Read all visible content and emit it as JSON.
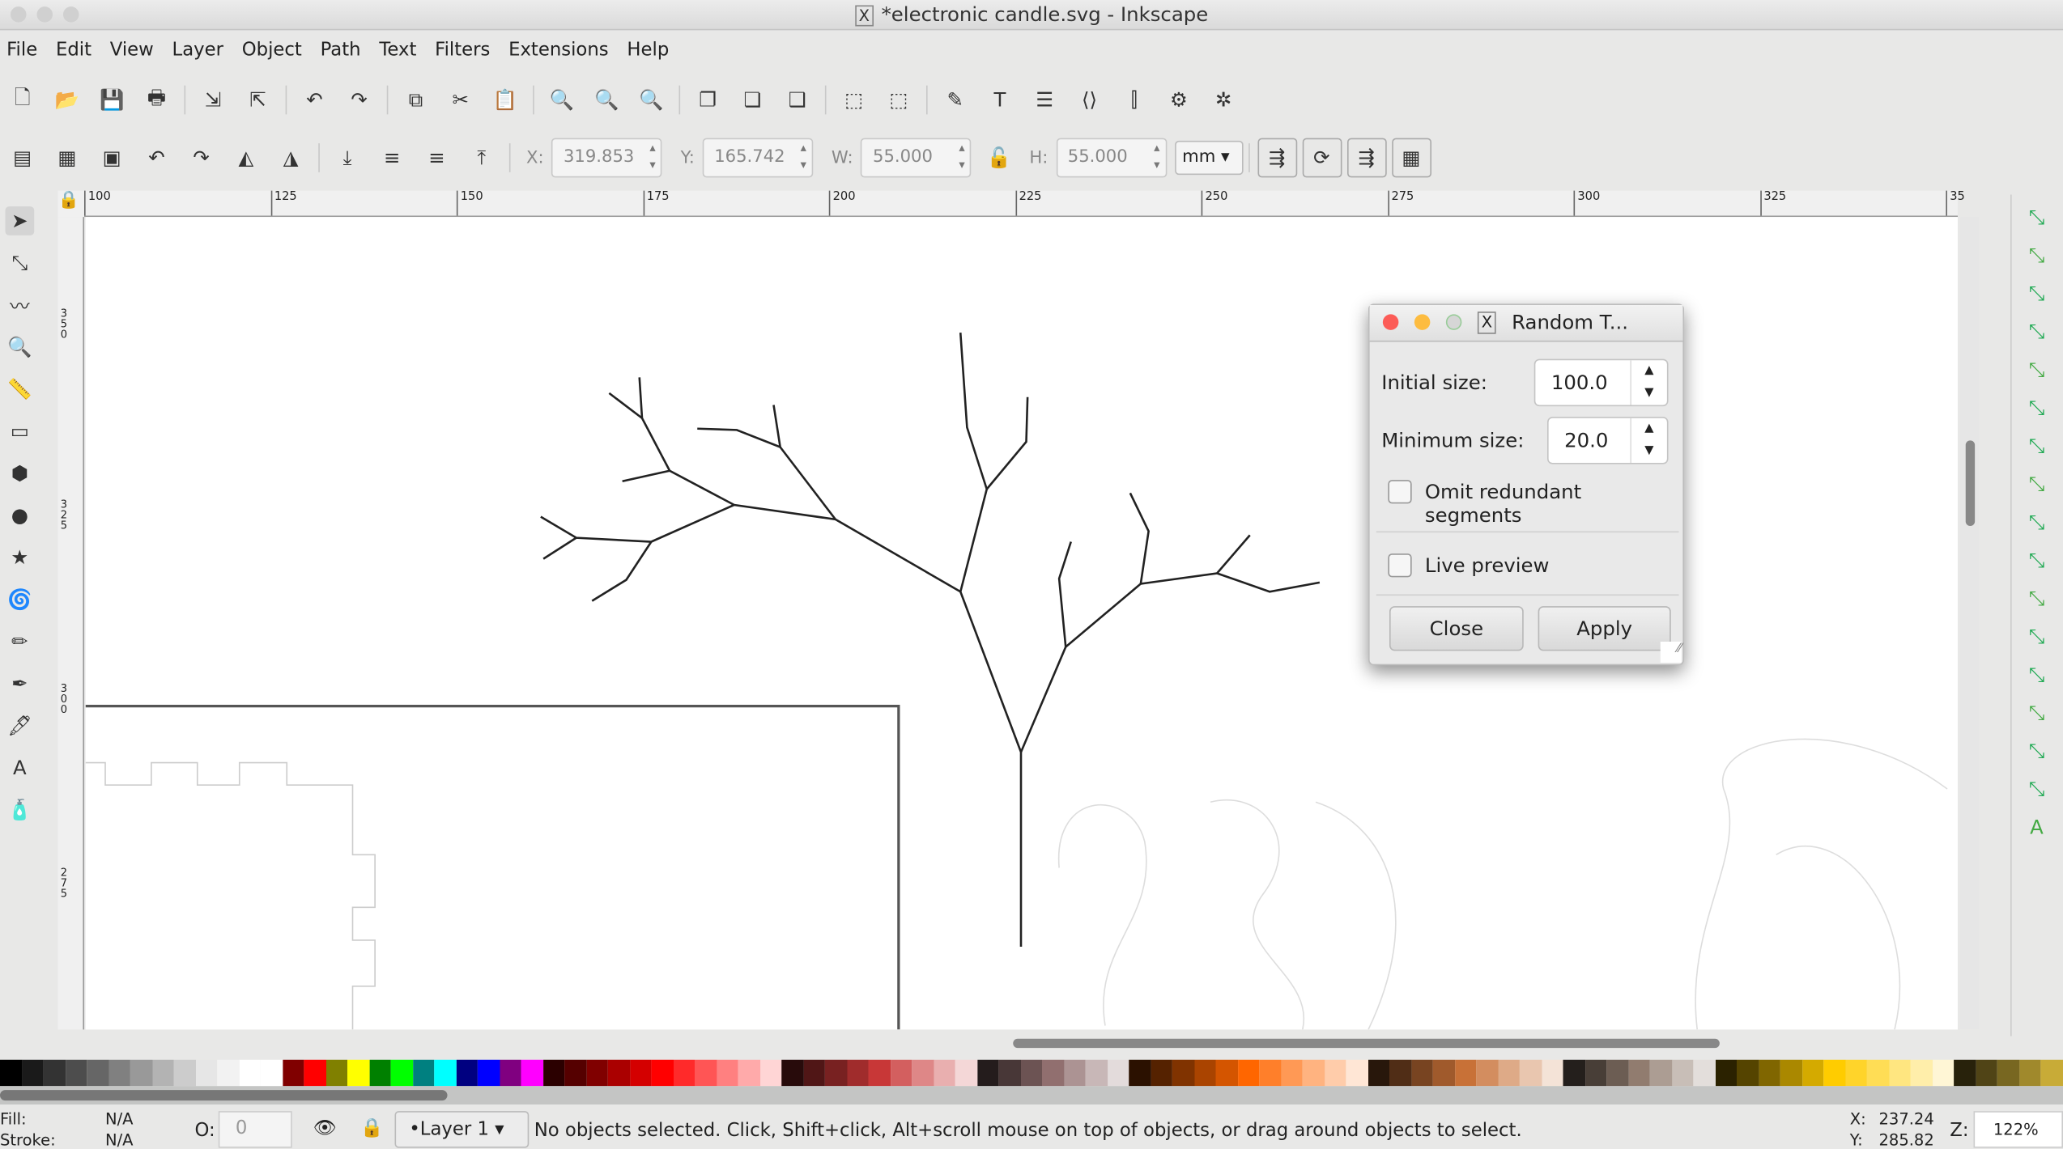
{
  "window": {
    "title": "*electronic candle.svg - Inkscape"
  },
  "menu": [
    "File",
    "Edit",
    "View",
    "Layer",
    "Object",
    "Path",
    "Text",
    "Filters",
    "Extensions",
    "Help"
  ],
  "toolbar_icons": [
    "new-document-icon",
    "open-icon",
    "save-icon",
    "print-icon",
    "import-icon",
    "export-icon",
    "undo-icon",
    "redo-icon",
    "copy-icon",
    "cut-icon",
    "paste-icon",
    "zoom-selection-icon",
    "zoom-drawing-icon",
    "zoom-page-icon",
    "duplicate-icon",
    "clone-icon",
    "unlink-clone-icon",
    "group-icon",
    "ungroup-icon",
    "fill-stroke-icon",
    "text-font-icon",
    "layers-icon",
    "xml-editor-icon",
    "align-icon",
    "document-properties-icon",
    "preferences-icon"
  ],
  "select_toolbar": {
    "x_label": "X:",
    "x": "319.853",
    "y_label": "Y:",
    "y": "165.742",
    "w_label": "W:",
    "w": "55.000",
    "h_label": "H:",
    "h": "55.000",
    "unit": "mm"
  },
  "ruler_top": [
    "100",
    "125",
    "150",
    "175",
    "200",
    "225",
    "250",
    "275",
    "300",
    "325",
    "35"
  ],
  "ruler_left": [
    "350",
    "325",
    "300",
    "275"
  ],
  "tools": [
    "selector-tool-icon",
    "node-tool-icon",
    "tweak-tool-icon",
    "zoom-tool-icon",
    "measure-tool-icon",
    "rectangle-tool-icon",
    "3d-box-tool-icon",
    "ellipse-tool-icon",
    "star-tool-icon",
    "spiral-tool-icon",
    "pencil-tool-icon",
    "pen-tool-icon",
    "calligraphy-tool-icon",
    "text-tool-icon",
    "spray-tool-icon"
  ],
  "dialog": {
    "title": "Random T...",
    "initial_size_label": "Initial size:",
    "initial_size": "100.0",
    "minimum_size_label": "Minimum size:",
    "minimum_size": "20.0",
    "omit_label": "Omit redundant segments",
    "omit_checked": false,
    "live_preview_label": "Live preview",
    "live_preview_checked": false,
    "close": "Close",
    "apply": "Apply"
  },
  "palette": [
    "#000000",
    "#1a1a1a",
    "#333333",
    "#4d4d4d",
    "#666666",
    "#808080",
    "#999999",
    "#b3b3b3",
    "#cccccc",
    "#e6e6e6",
    "#f2f2f2",
    "#ffffff",
    "#ffffff",
    "#800000",
    "#ff0000",
    "#808000",
    "#ffff00",
    "#008000",
    "#00ff00",
    "#008080",
    "#00ffff",
    "#000080",
    "#0000ff",
    "#800080",
    "#ff00ff",
    "#2b0000",
    "#550000",
    "#800000",
    "#aa0000",
    "#d40000",
    "#ff0000",
    "#ff2a2a",
    "#ff5555",
    "#ff8080",
    "#ffaaaa",
    "#ffd5d5",
    "#280b0b",
    "#501616",
    "#782121",
    "#a02c2c",
    "#c83737",
    "#d35f5f",
    "#de8787",
    "#e9afaf",
    "#f4d7d7",
    "#241c1c",
    "#483737",
    "#6c5353",
    "#916f6f",
    "#ac9393",
    "#c8b7b7",
    "#e3dbdb",
    "#2b1100",
    "#552200",
    "#803300",
    "#aa4400",
    "#d45500",
    "#ff6600",
    "#ff7f2a",
    "#ff9955",
    "#ffb380",
    "#ffccaa",
    "#ffe6d5",
    "#28170b",
    "#502d16",
    "#784421",
    "#a05a2c",
    "#c87137",
    "#d38d5f",
    "#deaa87",
    "#e9c6af",
    "#f4e3d7",
    "#241f1c",
    "#483e37",
    "#6c5d53",
    "#917c6f",
    "#ac9d93",
    "#c8beb7",
    "#e3dedb",
    "#2b2200",
    "#554400",
    "#806600",
    "#aa8800",
    "#d4aa00",
    "#ffcc00",
    "#ffd42a",
    "#ffdd55",
    "#ffe680",
    "#ffeeaa",
    "#fff6d5",
    "#28220b",
    "#504416",
    "#786721",
    "#a0892c",
    "#c8ab37"
  ],
  "status": {
    "fill_label": "Fill:",
    "fill": "N/A",
    "stroke_label": "Stroke:",
    "stroke": "N/A",
    "opacity_label": "O:",
    "opacity": "0",
    "layer": "•Layer 1",
    "message": "No objects selected. Click, Shift+click, Alt+scroll mouse on top of objects, or drag around objects to select.",
    "x_label": "X:",
    "x": "237.24",
    "y_label": "Y:",
    "y": "285.82",
    "zoom_label": "Z:",
    "zoom": "122%"
  }
}
